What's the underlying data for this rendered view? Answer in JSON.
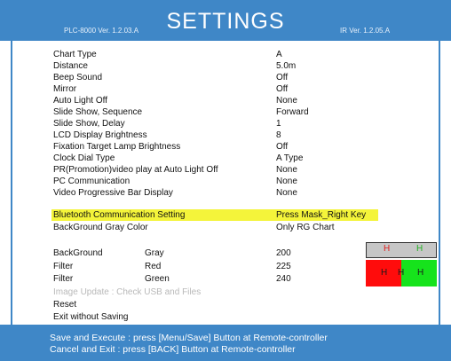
{
  "header": {
    "title": "SETTINGS",
    "left_version": "PLC-8000 Ver. 1.2.03.A",
    "right_version": "IR Ver. 1.2.05.A"
  },
  "settings": [
    {
      "label": "Chart Type",
      "value": "A"
    },
    {
      "label": "Distance",
      "value": "5.0m"
    },
    {
      "label": "Beep Sound",
      "value": "Off"
    },
    {
      "label": "Mirror",
      "value": "Off"
    },
    {
      "label": "Auto Light Off",
      "value": "None"
    },
    {
      "label": "Slide Show, Sequence",
      "value": "Forward"
    },
    {
      "label": "Slide Show, Delay",
      "value": "1"
    },
    {
      "label": "LCD Display Brightness",
      "value": "8"
    },
    {
      "label": "Fixation Target Lamp Brightness",
      "value": "Off"
    },
    {
      "label": "Clock Dial Type",
      "value": "A Type"
    },
    {
      "label": "PR(Promotion)video play at Auto Light Off",
      "value": "None"
    },
    {
      "label": "PC Communication",
      "value": "None"
    },
    {
      "label": "Video Progressive Bar Display",
      "value": "None"
    },
    {
      "label": "Bluetooth Communication Setting",
      "value": "Press Mask_Right Key"
    },
    {
      "label": "BackGround Gray Color",
      "value": "Only RG Chart"
    }
  ],
  "color_settings": [
    {
      "label": "BackGround",
      "sub": "Gray",
      "value": "200"
    },
    {
      "label": "Filter",
      "sub": "Red",
      "value": "225"
    },
    {
      "label": "Filter",
      "sub": "Green",
      "value": "240"
    }
  ],
  "actions": {
    "image_update": "Image Update : Check USB and Files",
    "reset": "Reset",
    "exit": "Exit without Saving"
  },
  "preview": {
    "glyph": "H",
    "gray": "#c6c6c6",
    "red": "#ff0c0c",
    "green": "#16e31c",
    "top_left_glyph_color": "#e02020",
    "top_right_glyph_color": "#22b022",
    "bottom_glyph_color": "#1a1a1a"
  },
  "footer": {
    "line1": "Save and Execute : press [Menu/Save] Button at Remote-controller",
    "line2": "Cancel and Exit    : press [BACK] Button at Remote-controller"
  },
  "colors": {
    "accent": "#3f87c7",
    "highlight": "#f4f43a",
    "disabled_text": "#b9b9b9"
  }
}
